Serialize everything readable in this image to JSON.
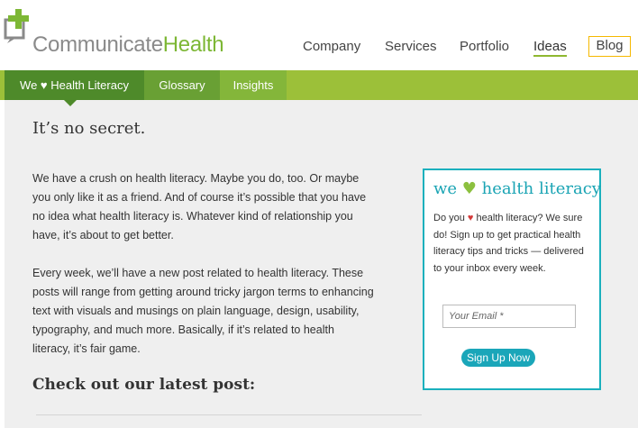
{
  "brand": {
    "name_part1": "Communicate",
    "name_part2": "Health",
    "color_gray": "#8a8a8a",
    "color_green": "#7db735"
  },
  "main_nav": {
    "items": [
      {
        "label": "Company"
      },
      {
        "label": "Services"
      },
      {
        "label": "Portfolio"
      },
      {
        "label": "Ideas",
        "active": true
      },
      {
        "label": "Blog"
      }
    ]
  },
  "sub_nav": {
    "items": [
      {
        "label": "We ♥ Health Literacy",
        "active": true
      },
      {
        "label": "Glossary"
      },
      {
        "label": "Insights"
      }
    ]
  },
  "main": {
    "heading": "It’s no secret.",
    "paragraph1": "We have a crush on health literacy. Maybe you do, too. Or maybe you only like it as a friend. And of course it’s possible that you have no idea what health literacy is. Whatever kind of relationship you have, it’s about to get better.",
    "paragraph2": "Every week, we’ll have a new post related to health literacy. These posts will range from getting around tricky jargon terms to enhancing text with visuals and musings on plain language, design, usability, typography, and much more. Basically, if it’s related to health literacy, it’s fair game.",
    "latest_heading": "Check out our latest post:"
  },
  "signup": {
    "title_pre": "we",
    "title_heart": "♥",
    "title_post": "health literacy",
    "text_pre": "Do you",
    "text_heart": "♥",
    "text_post": "health literacy? We sure do! Sign up to get practical health literacy tips and tricks — delivered to your inbox every week.",
    "email_placeholder": "Your Email *",
    "button_label": "Sign Up Now",
    "border_color": "#1ab0bd"
  },
  "colors": {
    "subnav_bar": "#9cc039",
    "subnav_active": "#4e8a2a",
    "content_bg": "#efefef",
    "blog_outline": "#f5b800"
  }
}
